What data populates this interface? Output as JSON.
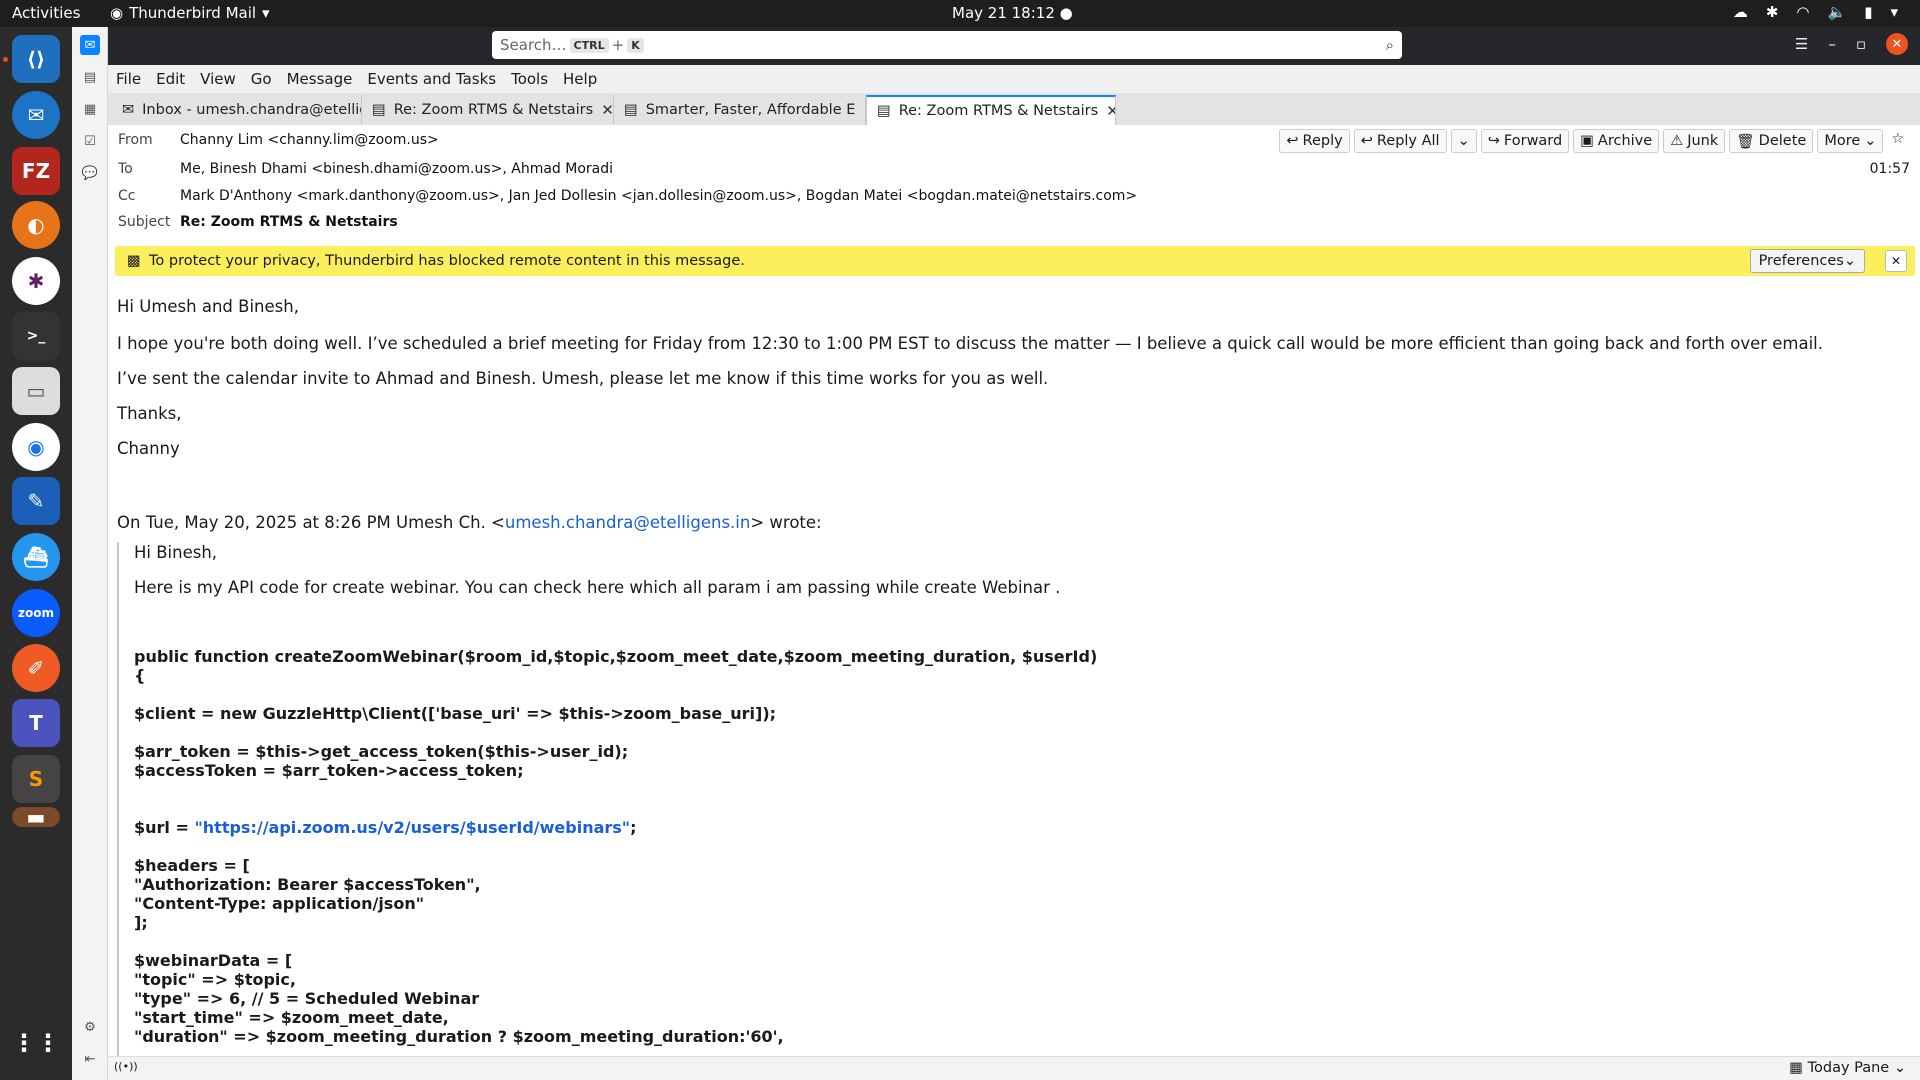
{
  "system": {
    "activities": "Activities",
    "app": "Thunderbird Mail",
    "clock": "May 21  18:12"
  },
  "search": {
    "placeholder": "Search…",
    "kbd1": "CTRL",
    "plus": "+",
    "kbd2": "K"
  },
  "menu": [
    "File",
    "Edit",
    "View",
    "Go",
    "Message",
    "Events and Tasks",
    "Tools",
    "Help"
  ],
  "tabs": [
    {
      "label": "Inbox - umesh.chandra@etelligens.in"
    },
    {
      "label": "Re: Zoom RTMS & Netstairs"
    },
    {
      "label": "Smarter, Faster, Affordable E"
    },
    {
      "label": "Re: Zoom RTMS & Netstairs"
    }
  ],
  "header": {
    "from_label": "From",
    "from": "Channy Lim <channy.lim@zoom.us>",
    "to_label": "To",
    "to": "Me, Binesh Dhami <binesh.dhami@zoom.us>, Ahmad Moradi",
    "cc_label": "Cc",
    "cc": "Mark D'Anthony <mark.danthony@zoom.us>, Jan Jed Dollesin <jan.dollesin@zoom.us>, Bogdan Matei <bogdan.matei@netstairs.com>",
    "subject_label": "Subject",
    "subject": "Re: Zoom RTMS & Netstairs",
    "time": "01:57"
  },
  "actions": {
    "reply": "Reply",
    "reply_all": "Reply All",
    "forward": "Forward",
    "archive": "Archive",
    "junk": "Junk",
    "delete": "Delete",
    "more": "More"
  },
  "banner": {
    "text": "To protect your privacy, Thunderbird has blocked remote content in this message.",
    "preferences": "Preferences"
  },
  "message": {
    "greeting": "Hi Umesh and Binesh,",
    "p1": "I hope you're both doing well. I’ve scheduled a brief meeting for Friday from 12:30 to 1:00 PM EST to discuss the matter — I believe a quick call would be more efficient than going back and forth over email.",
    "p2": "I’ve sent the calendar invite to Ahmad and Binesh. Umesh, please let me know if this time works for you as well.",
    "thanks": "Thanks,",
    "sign": "Channy",
    "quote_intro_a": "On Tue, May 20, 2025 at 8:26 PM Umesh Ch. <",
    "quote_email": "umesh.chandra@etelligens.in",
    "quote_intro_b": "> wrote:",
    "q_greeting": "Hi Binesh,",
    "q_p1": "Here is my API code for create webinar. You can check here which all param i am passing while create Webinar .",
    "code1": "public function createZoomWebinar($room_id,$topic,$zoom_meet_date,$zoom_meeting_duration, $userId)",
    "code2": "    {",
    "code3": "        $client = new GuzzleHttp\\Client(['base_uri' => $this->zoom_base_uri]);",
    "code4": "            $arr_token = $this->get_access_token($this->user_id);",
    "code5": "            $accessToken = $arr_token->access_token;",
    "code6a": "        $url = ",
    "code6link": "\"https://api.zoom.us/v2/users/$userId/webinars\"",
    "code6b": ";",
    "code7": "        $headers = [",
    "code8": "            \"Authorization: Bearer $accessToken\",",
    "code9": "            \"Content-Type: application/json\"",
    "code10": "        ];",
    "code11": "        $webinarData = [",
    "code12": "            \"topic\" => $topic,",
    "code13": "            \"type\" => 6, // 5 = Scheduled Webinar",
    "code14": "            \"start_time\" => $zoom_meet_date,",
    "code15": "            \"duration\" => $zoom_meeting_duration ? $zoom_meeting_duration:'60',"
  },
  "status": {
    "today": "Today Pane"
  }
}
